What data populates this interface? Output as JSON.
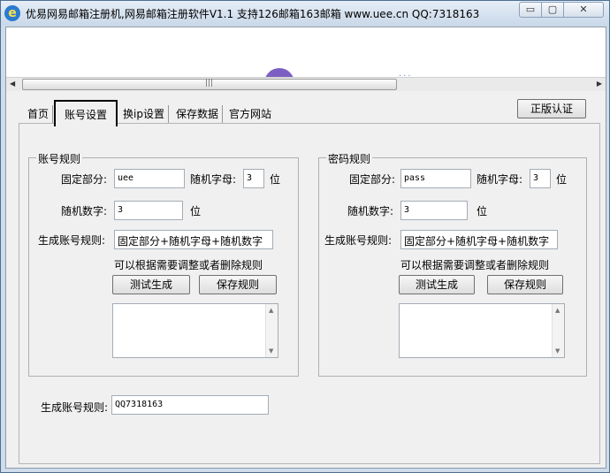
{
  "window": {
    "title": "优易网易邮箱注册机,网易邮箱注册软件V1.1 支持126邮箱163邮箱 www.uee.cn QQ:7318163",
    "icon_letter": "e",
    "min_glyph": "▭",
    "max_glyph": "▢",
    "close_glyph": "✕"
  },
  "banner": {
    "dots": "···"
  },
  "scroll": {
    "left": "◀",
    "right": "▶",
    "grip": "|||"
  },
  "tabs": [
    "首页",
    "账号设置",
    "换ip设置",
    "保存数据",
    "官方网站"
  ],
  "auth_button": "正版认证",
  "account": {
    "title": "账号规则",
    "fixed_label": "固定部分:",
    "fixed_value": "uee",
    "rand_letter_label": "随机字母:",
    "rand_letter_value": "3",
    "unit": "位",
    "rand_digit_label": "随机数字:",
    "rand_digit_value": "3",
    "rule_label": "生成账号规则:",
    "rule_value": "固定部分+随机字母+随机数字",
    "hint": "可以根据需要调整或者删除规则",
    "test_button": "测试生成",
    "save_button": "保存规则"
  },
  "password": {
    "title": "密码规则",
    "fixed_label": "固定部分:",
    "fixed_value": "pass",
    "rand_letter_label": "随机字母:",
    "rand_letter_value": "3",
    "unit": "位",
    "rand_digit_label": "随机数字:",
    "rand_digit_value": "3",
    "rule_label": "生成账号规则:",
    "rule_value": "固定部分+随机字母+随机数字",
    "hint": "可以根据需要调整或者删除规则",
    "test_button": "测试生成",
    "save_button": "保存规则"
  },
  "bottom": {
    "rule_label": "生成账号规则:",
    "rule_value": "QQ7318163"
  },
  "textarea_scroll": {
    "up": "▲",
    "down": "▼"
  }
}
